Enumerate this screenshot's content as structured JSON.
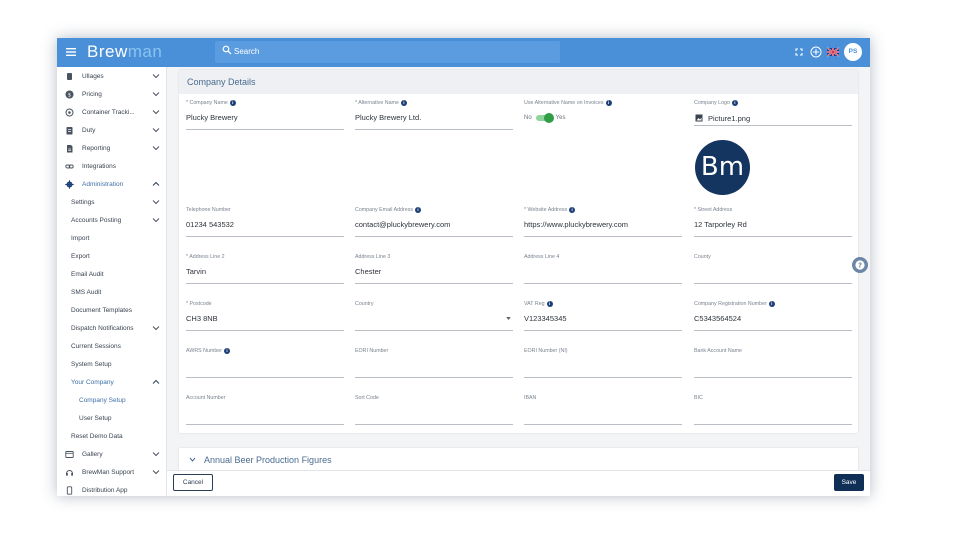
{
  "topbar": {
    "brand_part1": "Brew",
    "brand_part2": "man",
    "search_placeholder": "Search",
    "avatar_initials": "PS",
    "colors": {
      "bar": "#4a90d9",
      "accent": "#0f2f57"
    }
  },
  "sidebar": {
    "items": [
      {
        "label": "Ullages",
        "icon": "barrel-icon"
      },
      {
        "label": "Pricing",
        "icon": "money-icon"
      },
      {
        "label": "Container Tracki...",
        "icon": "target-icon"
      },
      {
        "label": "Duty",
        "icon": "ledger-icon"
      },
      {
        "label": "Reporting",
        "icon": "report-icon"
      },
      {
        "label": "Integrations",
        "icon": "link-icon"
      },
      {
        "label": "Administration",
        "icon": "gear-icon"
      },
      {
        "label": "Settings"
      },
      {
        "label": "Accounts Posting"
      },
      {
        "label": "Import"
      },
      {
        "label": "Export"
      },
      {
        "label": "Email Audit"
      },
      {
        "label": "SMS Audit"
      },
      {
        "label": "Document Templates"
      },
      {
        "label": "Dispatch Notifications"
      },
      {
        "label": "Current Sessions"
      },
      {
        "label": "System Setup"
      },
      {
        "label": "Your Company"
      },
      {
        "label": "Company Setup"
      },
      {
        "label": "User Setup"
      },
      {
        "label": "Reset Demo Data"
      },
      {
        "label": "Gallery",
        "icon": "gallery-icon"
      },
      {
        "label": "BrewMan Support",
        "icon": "support-icon"
      },
      {
        "label": "Distribution App",
        "icon": "phone-icon"
      }
    ]
  },
  "company_details": {
    "title": "Company Details",
    "fields": {
      "company_name": {
        "label": "* Company Name",
        "value": "Plucky Brewery"
      },
      "alternative_name": {
        "label": "* Alternative Name",
        "value": "Plucky Brewery Ltd."
      },
      "use_alt_name": {
        "label": "Use Alternative Name on Invoices",
        "off": "No",
        "on": "Yes",
        "state": "on"
      },
      "company_logo": {
        "label": "Company Logo",
        "value": "Picture1.png",
        "logo_text_b": "B",
        "logo_text_m": "m"
      },
      "telephone": {
        "label": "Telephone Number",
        "value": "01234 543532"
      },
      "email": {
        "label": "Company Email Address",
        "value": "contact@pluckybrewery.com"
      },
      "website": {
        "label": "* Website Address",
        "value": "https://www.pluckybrewery.com"
      },
      "street": {
        "label": "* Street Address",
        "value": "12 Tarporley Rd"
      },
      "address2": {
        "label": "* Address Line 2",
        "value": "Tarvin"
      },
      "address3": {
        "label": "Address Line 3",
        "value": "Chester"
      },
      "address4": {
        "label": "Address Line 4",
        "value": ""
      },
      "county": {
        "label": "County",
        "value": ""
      },
      "postcode": {
        "label": "* Postcode",
        "value": "CH3 8NB"
      },
      "country": {
        "label": "Country",
        "value": ""
      },
      "vat": {
        "label": "VAT Reg",
        "value": "V123345345"
      },
      "company_reg": {
        "label": "Company Registration Number",
        "value": "C5343564524"
      },
      "awrs": {
        "label": "AWRS Number",
        "value": ""
      },
      "eori": {
        "label": "EORI Number",
        "value": ""
      },
      "eori_ni": {
        "label": "EORI Number (NI)",
        "value": ""
      },
      "bank_account_name": {
        "label": "Bank Account Name",
        "value": ""
      },
      "account_number": {
        "label": "Account Number",
        "value": ""
      },
      "sort_code": {
        "label": "Sort Code",
        "value": ""
      },
      "iban": {
        "label": "IBAN",
        "value": ""
      },
      "bic": {
        "label": "BIC",
        "value": ""
      }
    }
  },
  "accordion": {
    "title": "Annual Beer Production Figures"
  },
  "footer": {
    "cancel": "Cancel",
    "save": "Save"
  }
}
